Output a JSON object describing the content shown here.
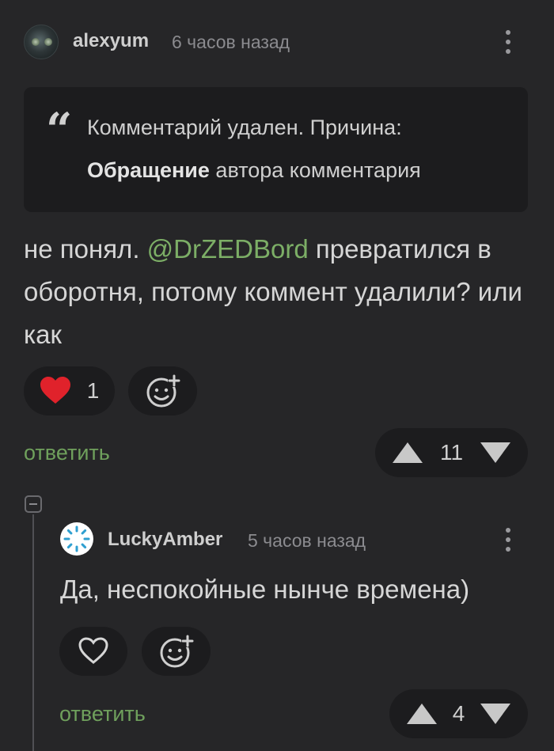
{
  "comment": {
    "author": "alexyum",
    "time": "6 часов назад",
    "deleted_notice": {
      "line1": "Комментарий удален. Причина:",
      "line2_bold": "Обращение",
      "line2_rest": " автора комментария"
    },
    "text_before": "не понял. ",
    "mention": "@DrZEDBord",
    "text_after": " превратился в оборотня, потому коммент удалили? или как",
    "likes": "1",
    "reply_label": "ответить",
    "rating": "11"
  },
  "reply": {
    "author": "LuckyAmber",
    "time": "5 часов назад",
    "text": "Да, неспокойные нынче времена)",
    "reply_label": "ответить",
    "rating": "4"
  },
  "colors": {
    "background": "#262628",
    "card": "#1c1c1e",
    "accent_green": "#6fa05c",
    "heart_red": "#e0222b"
  }
}
